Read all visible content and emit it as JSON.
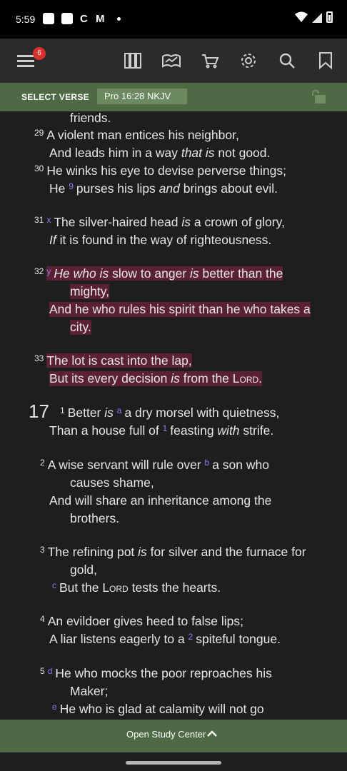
{
  "status": {
    "time": "5:59",
    "icon_c": "C",
    "icon_m": "M"
  },
  "toolbar": {
    "badge": "6",
    "icons": [
      "menu-icon",
      "library-icon",
      "reading-plan-icon",
      "cart-icon",
      "gear-icon",
      "search-icon",
      "bookmark-icon"
    ]
  },
  "verse_bar": {
    "label": "SELECT VERSE",
    "reference": "Pro 16:28 NKJV"
  },
  "reader": {
    "lines": [
      {
        "t": "friends."
      },
      {
        "n": "29",
        "t": "A violent man entices his neighbor,"
      },
      {
        "a": "And leads him in a way ",
        "b": "that is",
        "c": " not good."
      },
      {
        "n": "30",
        "t": "He winks his eye to devise perverse things;"
      },
      {
        "a": "He ",
        "fn": "9",
        "c": "purses his lips ",
        "b": "and",
        "d": " brings about evil."
      },
      {
        "n": "31",
        "fn": "x",
        "t": "The silver-haired head ",
        "b": "is",
        "c": " a crown of glory,"
      },
      {
        "b": "If",
        "c": " it is found in the way of righteousness."
      },
      {
        "n": "32",
        "fn": "y",
        "b": "He who is",
        "c": " slow to anger ",
        "b2": "is",
        "d": " better than the"
      },
      {
        "t": "mighty,"
      },
      {
        "t": "And he who rules his spirit than he who takes a"
      },
      {
        "t": "city."
      },
      {
        "n": "33",
        "t": "The lot is cast into the lap,"
      },
      {
        "a": "But its every decision ",
        "b": "is",
        "c": " from the ",
        "sc": "Lord",
        "d": "."
      },
      {
        "chapter": "17",
        "n": "1",
        "a": "Better ",
        "b": "is",
        "fn": "a",
        "c": "a dry morsel with quietness,"
      },
      {
        "a": "Than a house full of ",
        "fn": "1",
        "c": "feasting ",
        "b": "with",
        "d": " strife."
      },
      {
        "n": "2",
        "a": "A wise servant will rule over ",
        "fn": "b",
        "c": "a son who"
      },
      {
        "t": "causes shame,"
      },
      {
        "t": "And will share an inheritance among the"
      },
      {
        "t": "brothers."
      },
      {
        "n": "3",
        "a": "The refining pot ",
        "b": "is",
        "c": " for silver and the furnace for"
      },
      {
        "t": "gold,"
      },
      {
        "fn": "c",
        "a": "But the ",
        "sc": "Lord",
        "c": " tests the hearts."
      },
      {
        "n": "4",
        "t": "An evildoer gives heed to false lips;"
      },
      {
        "a": "A liar listens eagerly to a ",
        "fn": "2",
        "c": "spiteful tongue."
      },
      {
        "n": "5",
        "fn": "d",
        "t": "He who mocks the poor reproaches his"
      },
      {
        "t": "Maker;"
      },
      {
        "fn": "e",
        "t": "He who is glad at calamity will not go"
      }
    ]
  },
  "bottom": {
    "label": "Open Study Center"
  }
}
